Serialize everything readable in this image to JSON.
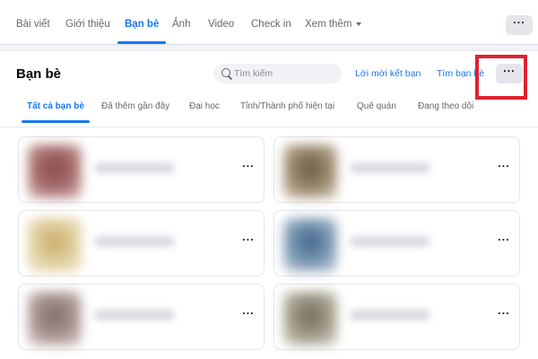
{
  "profile_tabs": [
    {
      "label": "Bài viết",
      "active": false
    },
    {
      "label": "Giới thiệu",
      "active": false
    },
    {
      "label": "Bạn bè",
      "active": true
    },
    {
      "label": "Ảnh",
      "active": false
    },
    {
      "label": "Video",
      "active": false
    },
    {
      "label": "Check in",
      "active": false
    },
    {
      "label": "Xem thêm",
      "active": false
    }
  ],
  "more_button": {
    "label": "···",
    "icon": "more-horizontal-icon"
  },
  "friends": {
    "title": "Bạn bè",
    "search": {
      "placeholder": "Tìm kiếm",
      "value": ""
    },
    "friend_requests_link": "Lời mời kết bạn",
    "find_friends_link": "Tìm bạn bè",
    "options_button": "···",
    "filter_tabs": [
      {
        "label": "Tất cả bạn bè",
        "active": true
      },
      {
        "label": "Đã thêm gần đây",
        "active": false
      },
      {
        "label": "Đại học",
        "active": false
      },
      {
        "label": "Tỉnh/Thành phố hiện tại",
        "active": false
      },
      {
        "label": "Quê quán",
        "active": false
      },
      {
        "label": "Đang theo dõi",
        "active": false
      }
    ],
    "list": [
      {
        "menu": "···"
      },
      {
        "menu": "···"
      },
      {
        "menu": "···"
      },
      {
        "menu": "···"
      },
      {
        "menu": "···"
      },
      {
        "menu": "···"
      }
    ]
  },
  "colors": {
    "accent": "#1877f2",
    "highlight_box": "#e0212f",
    "text_secondary": "#65676b"
  }
}
